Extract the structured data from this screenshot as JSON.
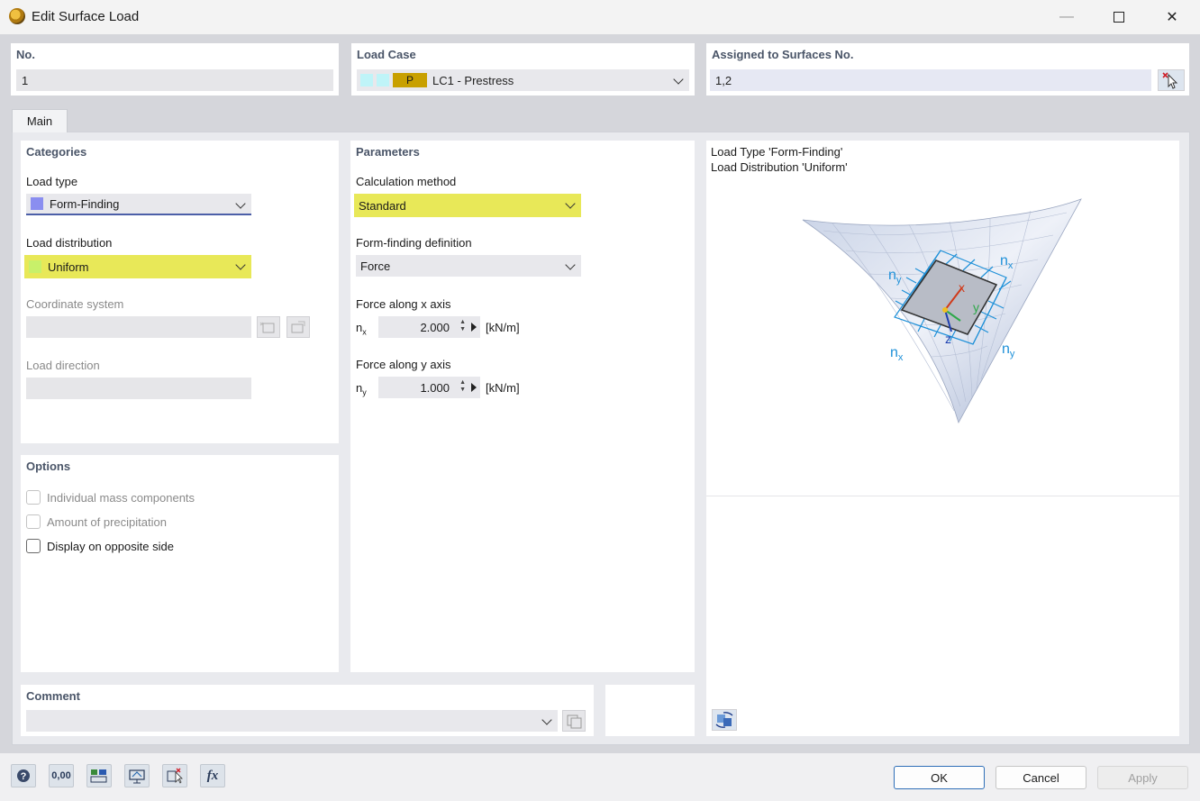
{
  "window": {
    "title": "Edit Surface Load"
  },
  "header": {
    "no": {
      "label": "No.",
      "value": "1"
    },
    "load_case": {
      "label": "Load Case",
      "tag": "P",
      "value": "LC1 - Prestress",
      "tag_color": "#c8a000"
    },
    "assigned": {
      "label": "Assigned to Surfaces No.",
      "value": "1,2"
    }
  },
  "tabs": [
    {
      "label": "Main"
    }
  ],
  "categories": {
    "title": "Categories",
    "load_type": {
      "label": "Load type",
      "value": "Form-Finding",
      "swatch_color": "#8a8ef0"
    },
    "load_distribution": {
      "label": "Load distribution",
      "value": "Uniform",
      "swatch_color": "#c8f06a"
    },
    "coordinate_system": {
      "label": "Coordinate system"
    },
    "load_direction": {
      "label": "Load direction"
    }
  },
  "parameters": {
    "title": "Parameters",
    "calculation_method": {
      "label": "Calculation method",
      "value": "Standard"
    },
    "form_finding_definition": {
      "label": "Form-finding definition",
      "value": "Force"
    },
    "force_x": {
      "label": "Force along x axis",
      "symbol": "n",
      "sub": "x",
      "value": "2.000",
      "unit": "[kN/m]"
    },
    "force_y": {
      "label": "Force along y axis",
      "symbol": "n",
      "sub": "y",
      "value": "1.000",
      "unit": "[kN/m]"
    }
  },
  "preview": {
    "line1": "Load Type 'Form-Finding'",
    "line2": "Load Distribution 'Uniform'",
    "labels": {
      "ny": "n",
      "ny_sub": "y",
      "nx": "n",
      "nx_sub": "x",
      "x": "x",
      "y": "y",
      "z": "z"
    }
  },
  "options": {
    "title": "Options",
    "items": [
      {
        "label": "Individual mass components",
        "checked": false,
        "disabled": true
      },
      {
        "label": "Amount of precipitation",
        "checked": false,
        "disabled": true
      },
      {
        "label": "Display on opposite side",
        "checked": false,
        "disabled": false
      }
    ]
  },
  "comment": {
    "label": "Comment",
    "value": ""
  },
  "footer": {
    "ok": "OK",
    "cancel": "Cancel",
    "apply": "Apply"
  },
  "toolbar": {
    "decimals_label": "0,00",
    "fx_label": "fx"
  },
  "colors": {
    "accent": "#2f6fb8",
    "highlight": "#e8e858",
    "panel_title": "#4a5568",
    "load_arrows": "#1e90d8"
  }
}
